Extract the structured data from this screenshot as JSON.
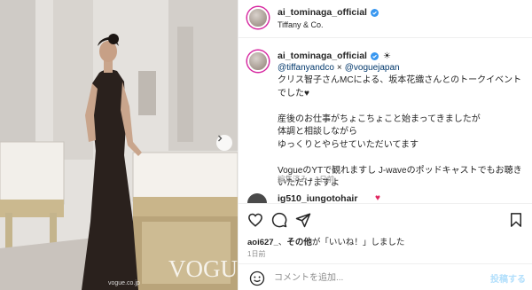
{
  "header": {
    "username": "ai_tominaga_official",
    "location": "Tiffany & Co."
  },
  "caption": {
    "username": "ai_tominaga_official",
    "emoji": "☀",
    "mention_1": "@tiffanyandco",
    "separator": "×",
    "mention_2": "@voguejapan",
    "text": "クリス智子さんMCによる、坂本花織さんとのトークイベントでした♥\n\n産後のお仕事がちょこちょこと始まってきましたが\n体調と相談しながら\nゆっくりとやらせていただいてます\n\nVogueのYTで観れますし J-waveのポッドキャストでもお聴きいただけますよ",
    "meta": "編集済み・1日前"
  },
  "comment_peek": {
    "username": "ig510_iungotohair",
    "emoji": "♥"
  },
  "likes": {
    "user": "aoi627_",
    "connector": "、",
    "others": "その他",
    "suffix": "が「いいね！」しました"
  },
  "date": "1日前",
  "add_comment": {
    "placeholder": "コメントを追加...",
    "post_label": "投稿する"
  },
  "photo": {
    "watermark": "VOGUE",
    "caption": "vogue.co.jp"
  },
  "icons": {
    "like": "heart-icon",
    "comment": "comment-icon",
    "share": "paper-plane-icon",
    "save": "bookmark-icon",
    "emoji": "smiley-icon",
    "verified": "verified-badge-icon",
    "next": "chevron-right-icon"
  },
  "colors": {
    "verified": "#3897f0",
    "link": "#00376b",
    "muted": "#8e8e8e",
    "post_button": "#b2dffc",
    "heart": "#e0245e"
  }
}
